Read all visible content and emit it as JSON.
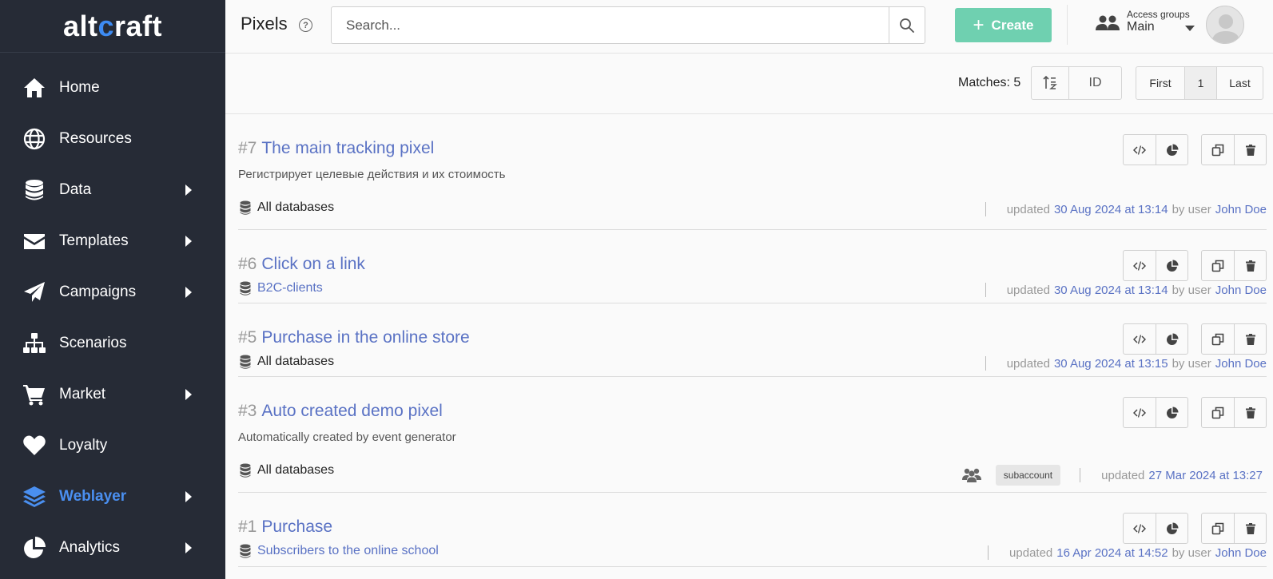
{
  "app": {
    "logo_left": "alt",
    "logo_accent": "c",
    "logo_right": "raft"
  },
  "sidebar": {
    "items": [
      {
        "label": "Home",
        "icon": "home-icon",
        "has_arrow": false,
        "active": false
      },
      {
        "label": "Resources",
        "icon": "globe-icon",
        "has_arrow": false,
        "active": false
      },
      {
        "label": "Data",
        "icon": "database-icon",
        "has_arrow": true,
        "active": false
      },
      {
        "label": "Templates",
        "icon": "envelope-icon",
        "has_arrow": true,
        "active": false
      },
      {
        "label": "Campaigns",
        "icon": "paper-plane-icon",
        "has_arrow": true,
        "active": false
      },
      {
        "label": "Scenarios",
        "icon": "sitemap-icon",
        "has_arrow": false,
        "active": false
      },
      {
        "label": "Market",
        "icon": "cart-icon",
        "has_arrow": true,
        "active": false
      },
      {
        "label": "Loyalty",
        "icon": "heart-icon",
        "has_arrow": false,
        "active": false
      },
      {
        "label": "Weblayer",
        "icon": "layers-icon",
        "has_arrow": true,
        "active": true
      },
      {
        "label": "Analytics",
        "icon": "pie-chart-icon",
        "has_arrow": true,
        "active": false
      }
    ],
    "active_color": "#4a8ff0",
    "bg_color": "#262b36"
  },
  "header": {
    "title": "Pixels",
    "help": "?",
    "search_placeholder": "Search...",
    "search_value": "",
    "create_plus": "+",
    "create_label": "Create",
    "create_color": "#6fd0b0",
    "access_label": "Access groups",
    "access_value": "Main"
  },
  "toolbar": {
    "matches": "Matches: 5",
    "sort_field": "ID",
    "pager": {
      "first": "First",
      "current": "1",
      "last": "Last"
    }
  },
  "pixels": [
    {
      "id": "#7",
      "name": "The  main tracking pixel",
      "description": "Регистрирует целевые действия и их стоимость",
      "database": "All databases",
      "db_link": false,
      "updated_prefix": "updated",
      "date": "30 Aug 2024 at 13:14",
      "by": "by user",
      "user": "John Doe",
      "group_badge": ""
    },
    {
      "id": "#6",
      "name": "Click on a link",
      "description": "",
      "database": "B2C-clients",
      "db_link": true,
      "updated_prefix": "updated",
      "date": "30 Aug 2024 at 13:14",
      "by": "by user",
      "user": "John Doe",
      "group_badge": ""
    },
    {
      "id": "#5",
      "name": "Purchase in the online store",
      "description": "",
      "database": "All databases",
      "db_link": false,
      "updated_prefix": "updated",
      "date": "30 Aug 2024 at 13:15",
      "by": "by user",
      "user": "John Doe",
      "group_badge": ""
    },
    {
      "id": "#3",
      "name": "Auto created demo pixel",
      "description": "Automatically created by event generator",
      "database": "All databases",
      "db_link": false,
      "updated_prefix": "updated",
      "date": "27 Mar 2024 at 13:27",
      "by": "",
      "user": "",
      "group_badge": "subaccount"
    },
    {
      "id": "#1",
      "name": "Purchase",
      "description": "",
      "database": "Subscribers to the online school",
      "db_link": true,
      "updated_prefix": "updated",
      "date": "16 Apr 2024 at 14:52",
      "by": "by user",
      "user": "John Doe",
      "group_badge": ""
    }
  ],
  "colors": {
    "link": "#5a72c4",
    "muted": "#999999"
  }
}
